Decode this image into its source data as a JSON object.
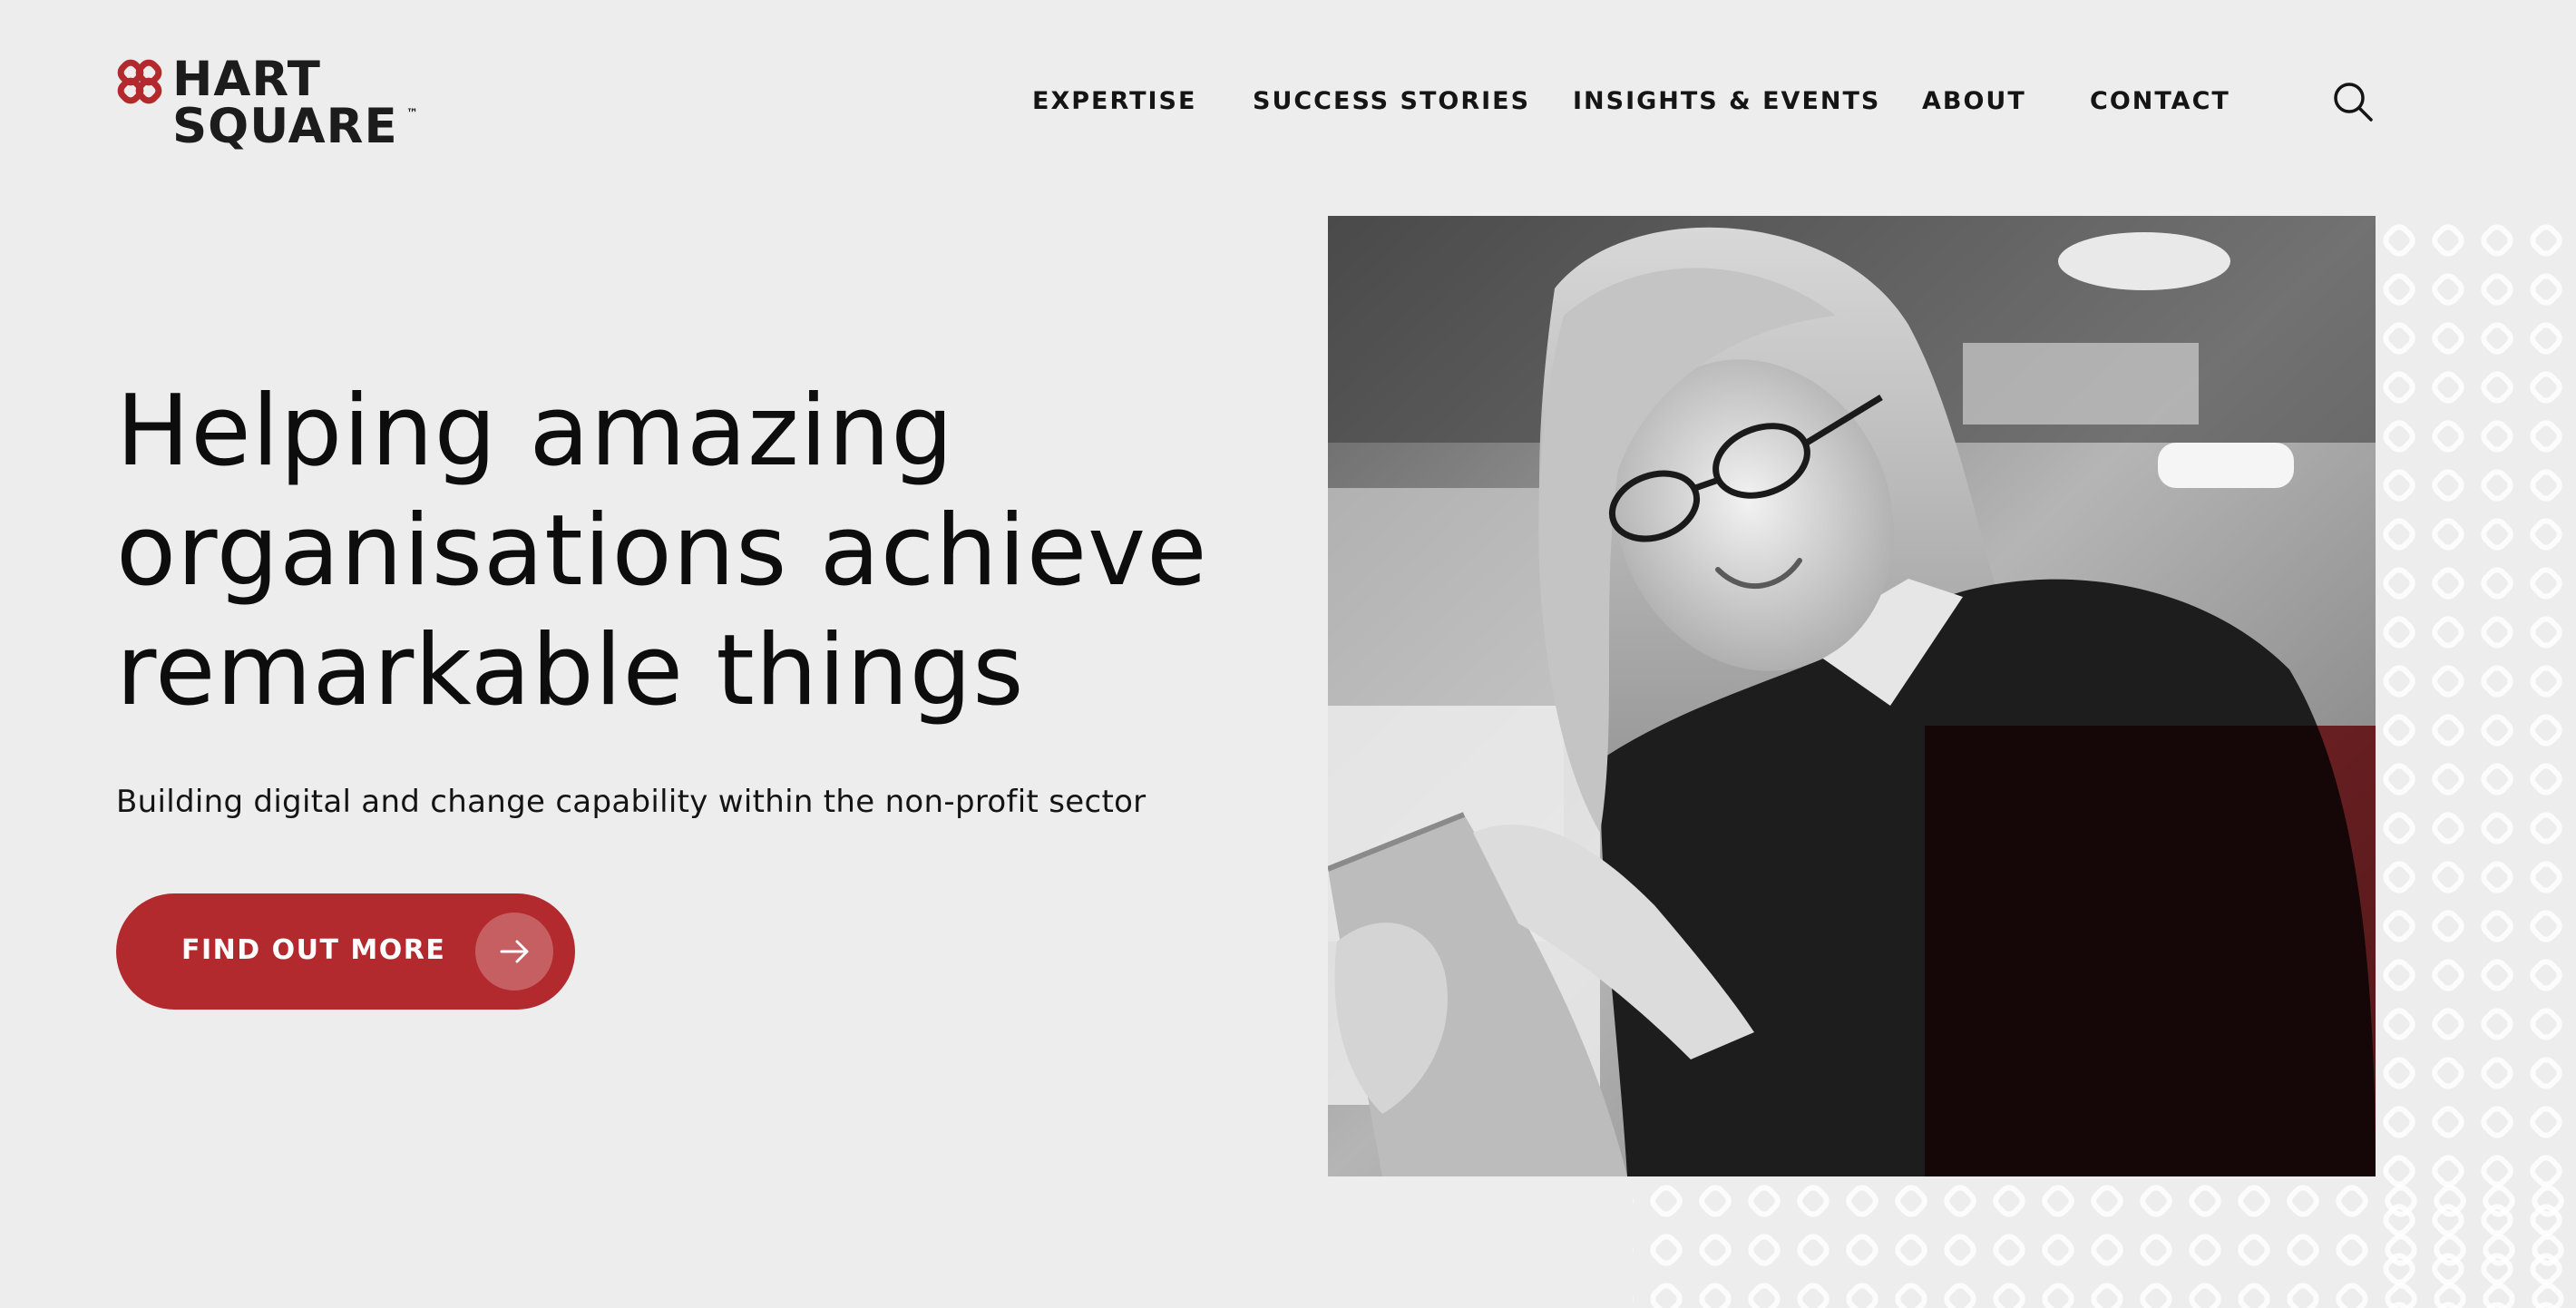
{
  "brand": {
    "line1": "HART",
    "line2": "SQUARE",
    "trademark": "™",
    "accent_color": "#b22a2e"
  },
  "nav": {
    "items": [
      {
        "label": "EXPERTISE"
      },
      {
        "label": "SUCCESS STORIES"
      },
      {
        "label": "INSIGHTS & EVENTS"
      },
      {
        "label": "ABOUT"
      },
      {
        "label": "CONTACT"
      }
    ],
    "search_icon": "search-icon"
  },
  "hero": {
    "title_line1": "Helping amazing",
    "title_line2": "organisations achieve",
    "title_line3": "remarkable things",
    "subtitle": "Building digital and change capability within the non-profit sector",
    "cta_label": "FIND OUT MORE",
    "cta_icon": "arrow-right-icon"
  },
  "image": {
    "subject": "woman-with-tablet-photo",
    "overlay_color": "#b22a2e"
  }
}
